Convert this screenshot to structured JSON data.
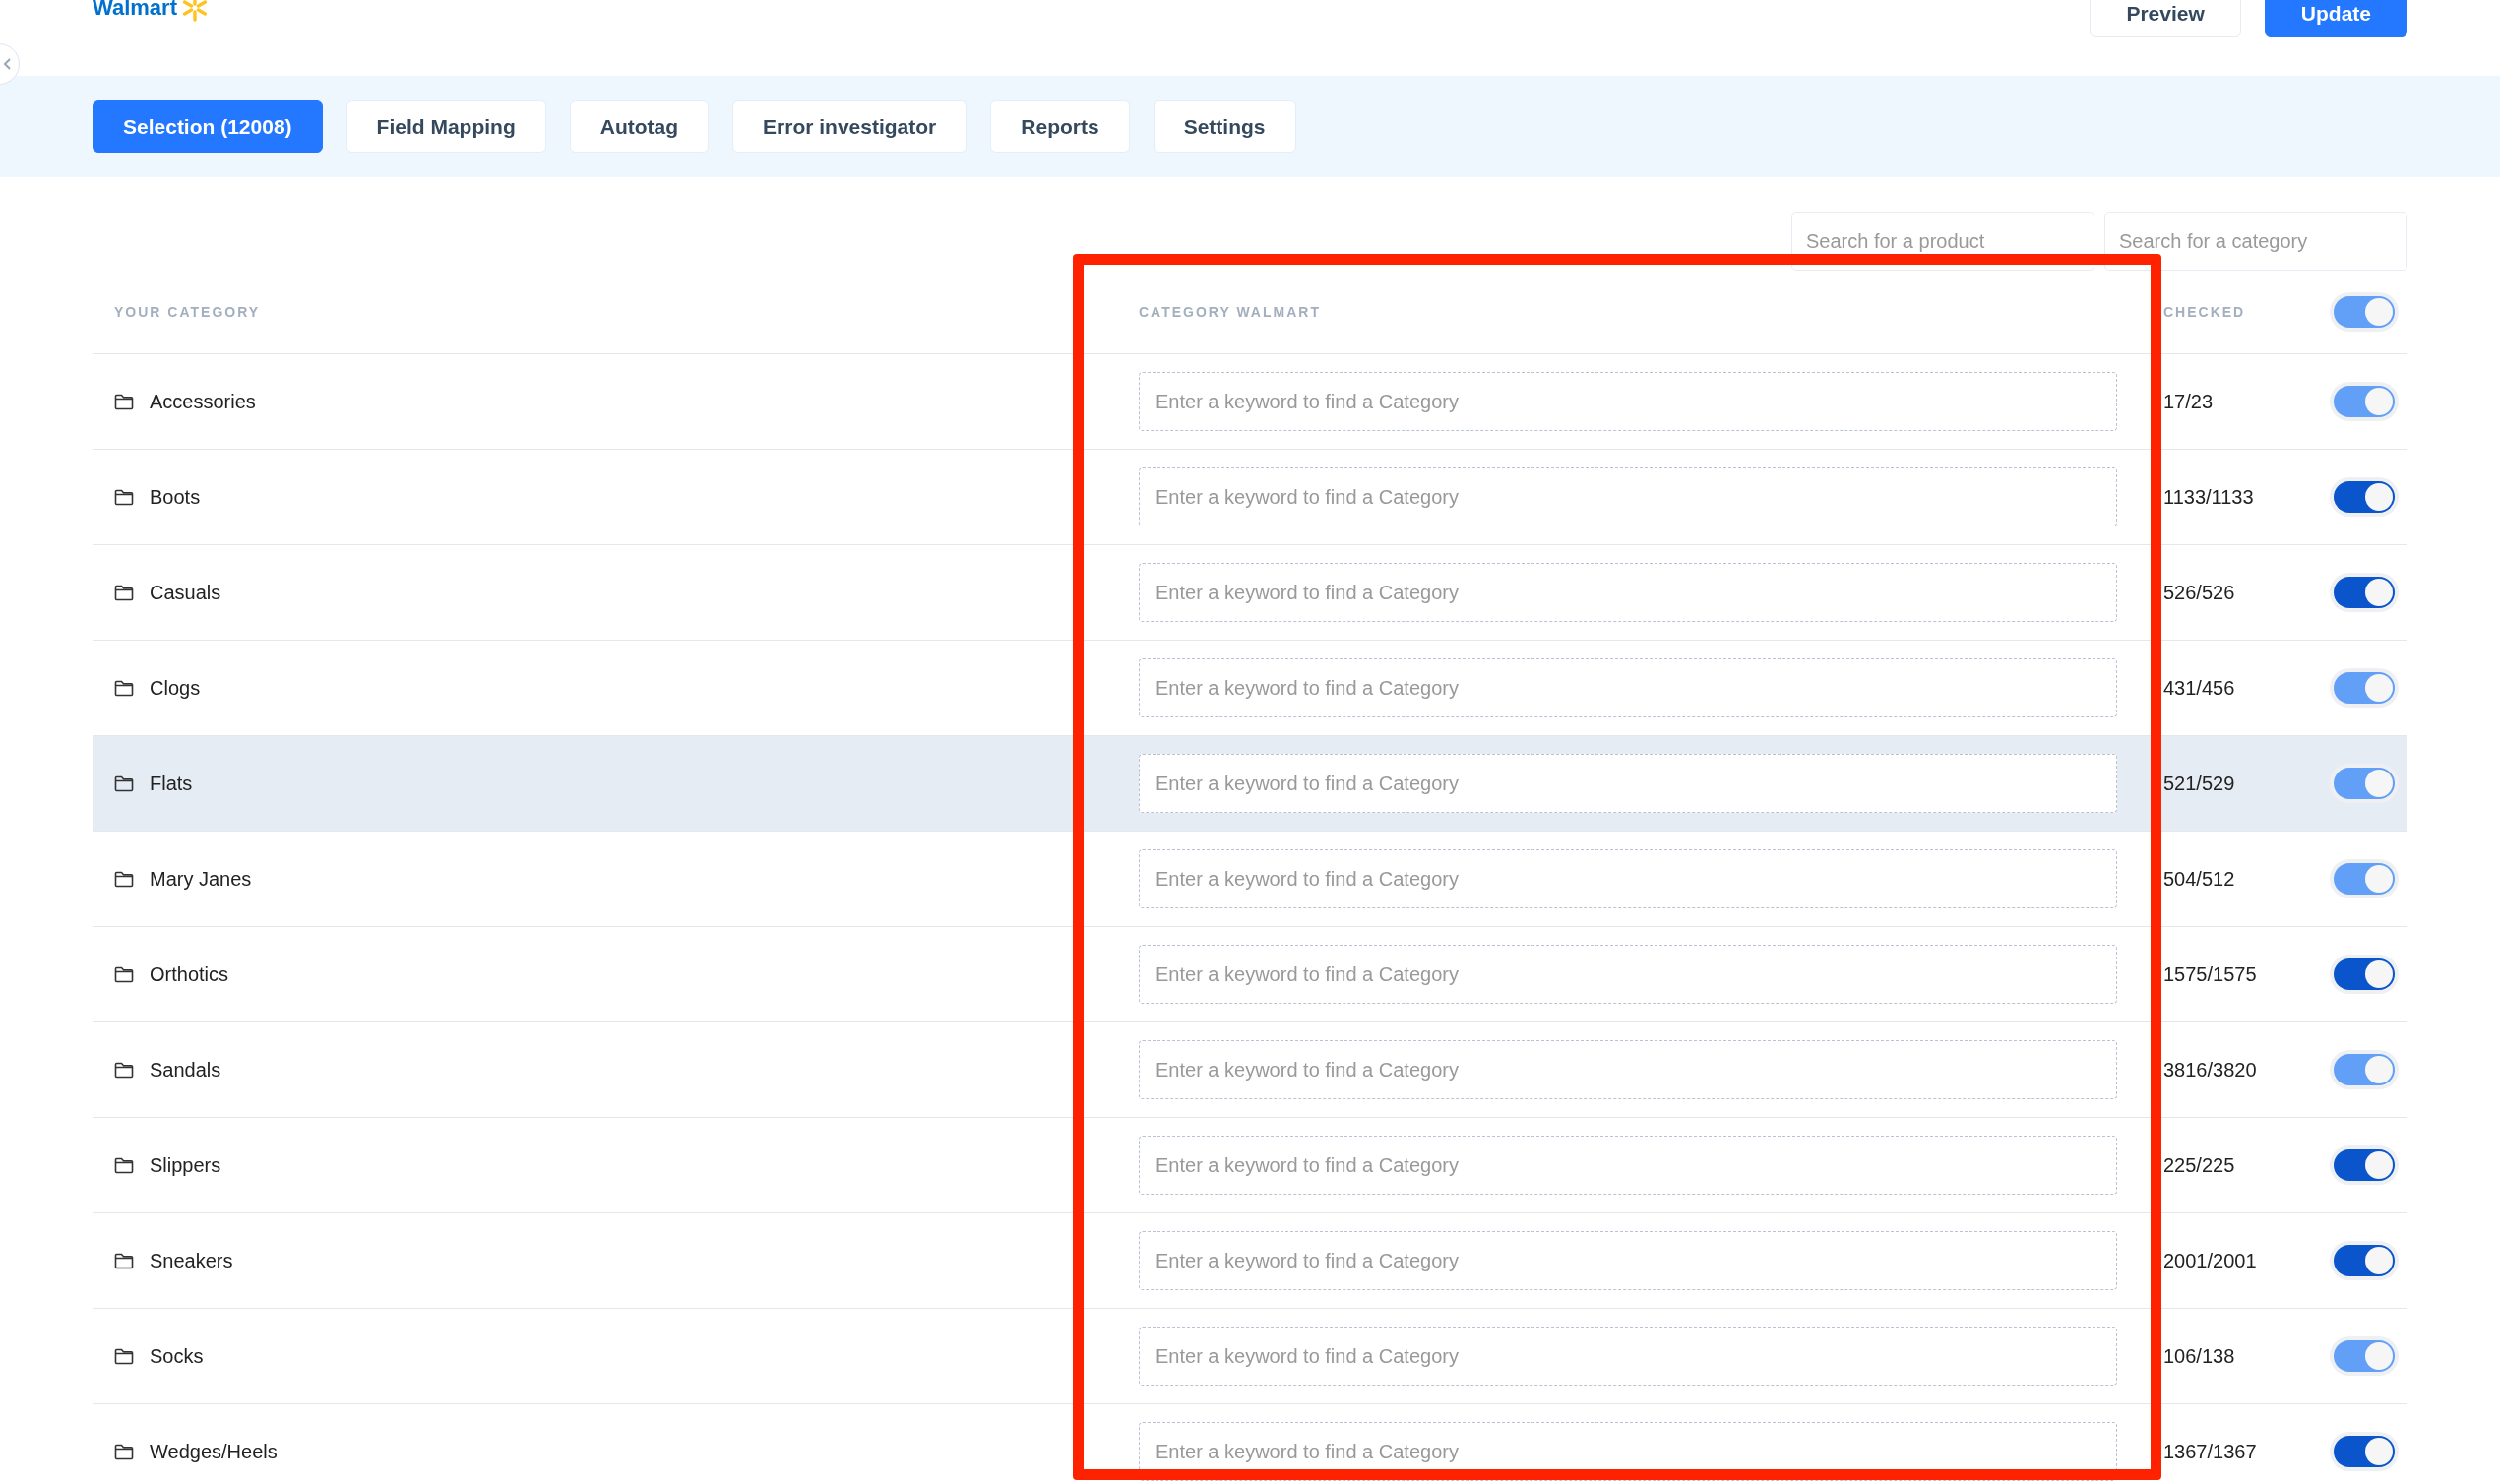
{
  "header": {
    "logo": "Walmart",
    "buttons": [
      {
        "label": "Preview",
        "kind": "secondary"
      },
      {
        "label": "Update",
        "kind": "primary"
      }
    ]
  },
  "tabs": [
    {
      "label": "Selection (12008)",
      "selected": true
    },
    {
      "label": "Field Mapping",
      "selected": false
    },
    {
      "label": "Autotag",
      "selected": false
    },
    {
      "label": "Error investigator",
      "selected": false
    },
    {
      "label": "Reports",
      "selected": false
    },
    {
      "label": "Settings",
      "selected": false
    }
  ],
  "search": [
    {
      "placeholder": "Search for a product"
    },
    {
      "placeholder": "Search for a category"
    }
  ],
  "table": {
    "columns": [
      "YOUR CATEGORY",
      "CATEGORY WALMART",
      "CHECKED"
    ],
    "header_toggle": {
      "on": true,
      "partial": true
    },
    "rows": [
      {
        "category": "Accessories",
        "placeholder": "Enter a keyword to find a Category",
        "checked": "17/23",
        "on": true,
        "partial": true,
        "highlighted": false
      },
      {
        "category": "Boots",
        "placeholder": "Enter a keyword to find a Category",
        "checked": "1133/1133",
        "on": true,
        "partial": false,
        "highlighted": false
      },
      {
        "category": "Casuals",
        "placeholder": "Enter a keyword to find a Category",
        "checked": "526/526",
        "on": true,
        "partial": false,
        "highlighted": false
      },
      {
        "category": "Clogs",
        "placeholder": "Enter a keyword to find a Category",
        "checked": "431/456",
        "on": true,
        "partial": true,
        "highlighted": false
      },
      {
        "category": "Flats",
        "placeholder": "Enter a keyword to find a Category",
        "checked": "521/529",
        "on": true,
        "partial": true,
        "highlighted": true
      },
      {
        "category": "Mary Janes",
        "placeholder": "Enter a keyword to find a Category",
        "checked": "504/512",
        "on": true,
        "partial": true,
        "highlighted": false
      },
      {
        "category": "Orthotics",
        "placeholder": "Enter a keyword to find a Category",
        "checked": "1575/1575",
        "on": true,
        "partial": false,
        "highlighted": false
      },
      {
        "category": "Sandals",
        "placeholder": "Enter a keyword to find a Category",
        "checked": "3816/3820",
        "on": true,
        "partial": true,
        "highlighted": false
      },
      {
        "category": "Slippers",
        "placeholder": "Enter a keyword to find a Category",
        "checked": "225/225",
        "on": true,
        "partial": false,
        "highlighted": false
      },
      {
        "category": "Sneakers",
        "placeholder": "Enter a keyword to find a Category",
        "checked": "2001/2001",
        "on": true,
        "partial": false,
        "highlighted": false
      },
      {
        "category": "Socks",
        "placeholder": "Enter a keyword to find a Category",
        "checked": "106/138",
        "on": true,
        "partial": true,
        "highlighted": false
      },
      {
        "category": "Wedges/Heels",
        "placeholder": "Enter a keyword to find a Category",
        "checked": "1367/1367",
        "on": true,
        "partial": false,
        "highlighted": false
      }
    ]
  },
  "highlight_frame": true
}
